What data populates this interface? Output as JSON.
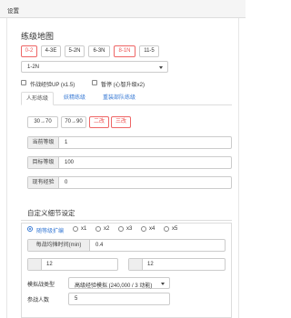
{
  "panel": {
    "title": "设置"
  },
  "map": {
    "title": "练级地图",
    "buttons": [
      "0-2",
      "4-3E",
      "5-2N",
      "6-3N",
      "8-1N",
      "11-5"
    ],
    "selected": "1-2N"
  },
  "options": {
    "sortie_up_label": "作战经验UP (x1.5)",
    "pause_label": "暂停 (心智升级x2)"
  },
  "tabs": [
    "人形练级",
    "妖精练级",
    "重装部队练级"
  ],
  "level_buttons": [
    "30→70",
    "70→90",
    "二改",
    "三改"
  ],
  "fields": {
    "current_level": {
      "label": "当前等级",
      "value": "1"
    },
    "target_level": {
      "label": "目标等级",
      "value": "100"
    },
    "existing_exp": {
      "label": "现有经验",
      "value": "0"
    }
  },
  "details": {
    "title": "自定义细节设定",
    "radio_label": "随等级扩编",
    "radio_opts": [
      "x1",
      "x2",
      "x3",
      "x4",
      "x5"
    ],
    "cycle_label": "每战均摊时间(min)",
    "cycle_value": "0.4",
    "left_value": "12",
    "right_value": "12",
    "battle_type_label": "模拟战类型",
    "battle_type_value": "高级经验模拟 (240,000 / 3 动能)",
    "participants_label": "参战人数",
    "participants_value": "5"
  }
}
